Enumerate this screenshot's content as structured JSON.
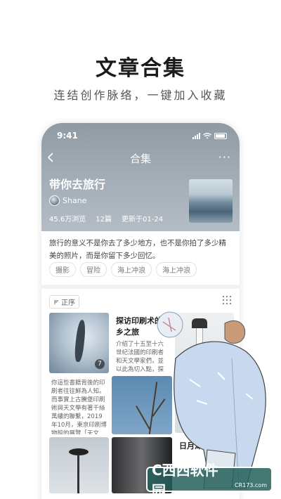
{
  "promo": {
    "title": "文章合集",
    "subtitle": "连结创作脉络，一键加入收藏"
  },
  "status_bar": {
    "time": "9:41"
  },
  "navbar": {
    "back_icon": "chevron-left-icon",
    "title": "合集",
    "more_icon": "more-dots-icon",
    "more_label": "···"
  },
  "collection": {
    "title": "带你去旅行",
    "author": "Shane",
    "views": "45.6万浏览",
    "count": "12篇",
    "updated": "更新于01-24",
    "description": "旅行的意义不是你去了多少地方，也不是你拍了多少精美的照片，而是你留下多少回忆。",
    "tags": [
      "摄影",
      "冒险",
      "海上冲浪",
      "海上冲浪"
    ]
  },
  "toolbar": {
    "sort_label": "正序",
    "sort_icon": "sort-icon",
    "grid_icon": "grid-view-icon"
  },
  "cards": {
    "c1_badge": "7",
    "c2_title": "探访印刷术的乡之旅",
    "c2_body": "介绍了十五至十六世纪法國的印刷者和天文學家們，並以此為切入點，探討了啟蒙",
    "c4_body": "你這些書籍背後的印刷者往往鮮為人知。而事實上古騰堡印刷術與天文學有著千絲萬縷的聯繫，2019年10月，東京印刷博物館的展覽「天文",
    "c8_title": "日月潭"
  },
  "watermark": {
    "logo": "C西西软件园",
    "brand": "软件园",
    "url": "CR173.com"
  },
  "colors": {
    "hero_gradient_top": "#8f9aa3",
    "hero_gradient_bottom": "#b4bdc5",
    "watermark_bg": "#245f5a",
    "watermark_text": "#ffe24a"
  }
}
